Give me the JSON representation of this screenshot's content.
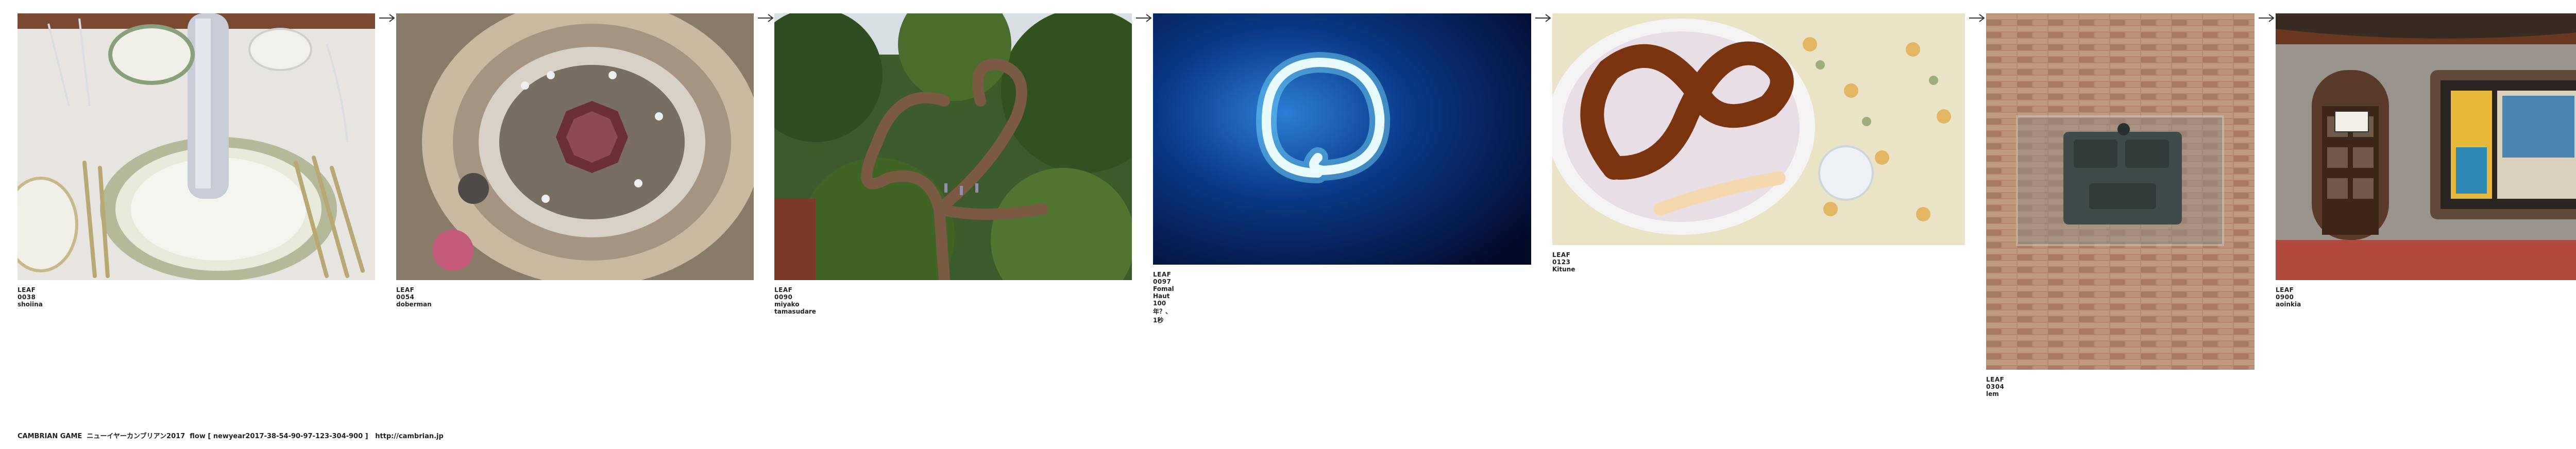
{
  "leaves": [
    {
      "id": "LEAF 0038",
      "author": "shoiina",
      "image": "dinner-table-photo"
    },
    {
      "id": "LEAF 0054",
      "author": "doberman",
      "image": "spiral-stair-photo"
    },
    {
      "id": "LEAF 0090",
      "author": "miyako tamasudare",
      "image": "twisted-tree-photo"
    },
    {
      "id": "LEAF 0097",
      "author": "Fomal Haut",
      "note": "100年？、1秒",
      "image": "neon-ring-photo"
    },
    {
      "id": "LEAF 0123",
      "author": "Kitune",
      "image": "pretzel-photo"
    },
    {
      "id": "LEAF 0304",
      "author": "lem",
      "image": "brick-meter-photo"
    },
    {
      "id": "LEAF 0900",
      "author": "aoinkia",
      "image": "shop-door-photo"
    }
  ],
  "footer": {
    "text": "CAMBRIAN GAME  ニューイヤーカンブリアン2017  flow [ newyear2017-38-54-90-97-123-304-900 ]   http://cambrian.jp"
  },
  "colors": {
    "arrow": "#333333",
    "text": "#222222"
  }
}
